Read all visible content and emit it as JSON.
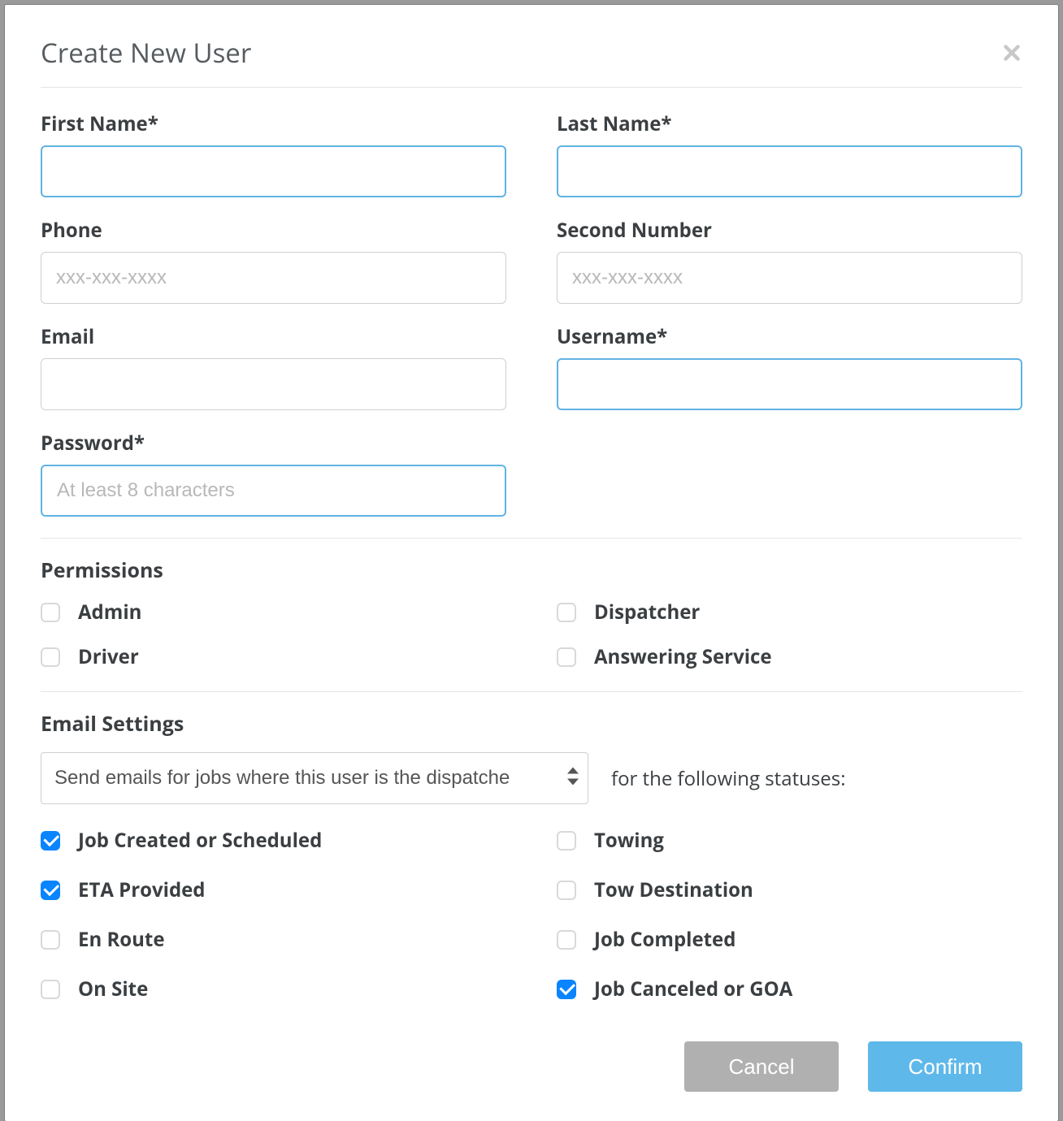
{
  "header": {
    "title": "Create New User"
  },
  "fields": {
    "first_name": {
      "label": "First Name*",
      "value": "",
      "placeholder": ""
    },
    "last_name": {
      "label": "Last Name*",
      "value": "",
      "placeholder": ""
    },
    "phone": {
      "label": "Phone",
      "value": "",
      "placeholder": "xxx-xxx-xxxx"
    },
    "second_number": {
      "label": "Second Number",
      "value": "",
      "placeholder": "xxx-xxx-xxxx"
    },
    "email": {
      "label": "Email",
      "value": "",
      "placeholder": ""
    },
    "username": {
      "label": "Username*",
      "value": "",
      "placeholder": ""
    },
    "password": {
      "label": "Password*",
      "value": "",
      "placeholder": "At least 8 characters"
    }
  },
  "permissions": {
    "title": "Permissions",
    "items": [
      {
        "label": "Admin",
        "checked": false
      },
      {
        "label": "Dispatcher",
        "checked": false
      },
      {
        "label": "Driver",
        "checked": false
      },
      {
        "label": "Answering Service",
        "checked": false
      }
    ]
  },
  "email_settings": {
    "title": "Email Settings",
    "select_value": "Send emails for jobs where this user is the dispatche",
    "suffix": "for the following statuses:",
    "statuses": [
      {
        "label": "Job Created or Scheduled",
        "checked": true
      },
      {
        "label": "Towing",
        "checked": false
      },
      {
        "label": "ETA Provided",
        "checked": true
      },
      {
        "label": "Tow Destination",
        "checked": false
      },
      {
        "label": "En Route",
        "checked": false
      },
      {
        "label": "Job Completed",
        "checked": false
      },
      {
        "label": "On Site",
        "checked": false
      },
      {
        "label": "Job Canceled or GOA",
        "checked": true
      }
    ]
  },
  "footer": {
    "cancel": "Cancel",
    "confirm": "Confirm"
  }
}
